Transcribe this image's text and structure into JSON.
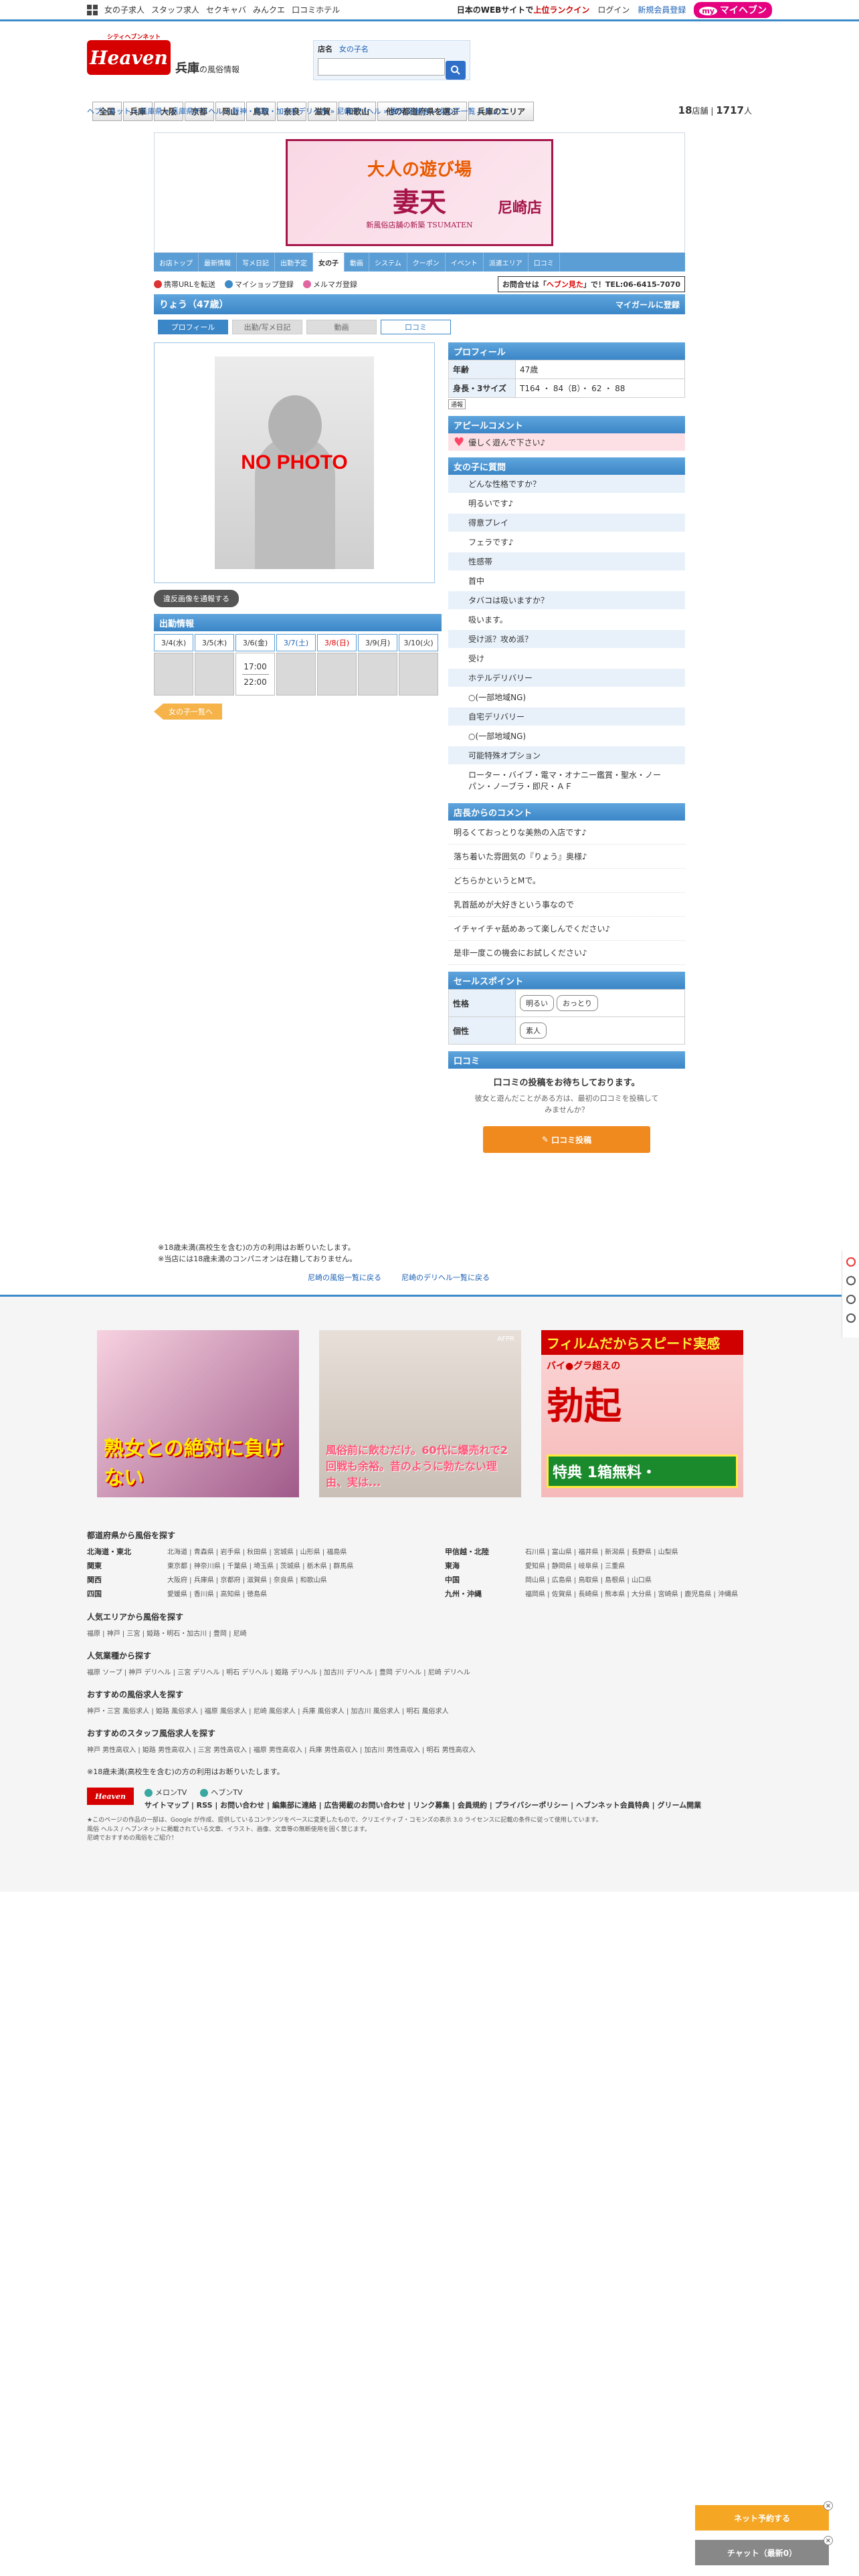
{
  "topbar": {
    "left_links": [
      "女の子求人",
      "スタッフ求人",
      "セクキャバ",
      "みんクエ",
      "口コミホテル"
    ],
    "right_links": [
      {
        "text": "日本のWEBサイトで",
        "style": "dark"
      },
      {
        "text": "上位ランクイン",
        "style": "hl"
      },
      {
        "text": "ログイン",
        "style": "plain"
      },
      {
        "text": "新規会員登録",
        "style": "blue"
      }
    ],
    "my_heaven": "マイヘブン",
    "my_badge": "my"
  },
  "header": {
    "logo_text": "Heaven",
    "logo_sub": "シティヘブンネット",
    "pref": "兵庫",
    "pref_sub": "の風俗情報",
    "search_label": "店名",
    "search_tab": "女の子名",
    "search_placeholder": ""
  },
  "gnav": [
    "全国",
    "兵庫",
    "大阪",
    "京都",
    "岡山",
    "鳥取",
    "奈良",
    "滋賀",
    "和歌山",
    "他の都道府県を選ぶ",
    "兵庫のエリア"
  ],
  "breadcrumb": "ヘブンネット » 兵庫県 » 兵庫県デリヘル » 阪神・尼崎・加古川デリヘル » 尼崎デリヘル » 妻天 尼崎店 » 女の子一覧 » りょう",
  "counts": {
    "shops": "18",
    "shops_unit": "店舗",
    "divider": "|",
    "girls": "1717",
    "girls_unit": "人"
  },
  "banner": {
    "t1": "大人の遊び場",
    "t2": "妻天",
    "t3": "尼崎店",
    "t4": "新風俗店舗の新築 TSUMATEN"
  },
  "subnav": [
    "お店トップ",
    "最新情報",
    "写メ日記",
    "出勤予定",
    "女の子",
    "動画",
    "システム",
    "クーポン",
    "イベント",
    "派遣エリア",
    "口コミ"
  ],
  "subnav_active": "女の子",
  "tools": {
    "items": [
      "携帯URLを転送",
      "マイショップ登録",
      "メルマガ登録"
    ],
    "tel_prefix": "お問合せは「",
    "tel_highlight": "ヘブン見た",
    "tel_suffix": "」で！TEL:06-6415-7070"
  },
  "girl": {
    "name": "りょう（47歳）",
    "mygirl": "マイガールに登録"
  },
  "ptabs": [
    "プロフィール",
    "出勤/写メ日記",
    "動画",
    "口コミ"
  ],
  "photo": {
    "label": "NO PHOTO"
  },
  "violate_btn": "違反画像を通報する",
  "schedule": {
    "title": "出勤情報",
    "days": [
      {
        "label": "3/4(水)",
        "type": "",
        "time_start": "",
        "time_end": "",
        "on": false
      },
      {
        "label": "3/5(木)",
        "type": "",
        "time_start": "",
        "time_end": "",
        "on": false
      },
      {
        "label": "3/6(金)",
        "type": "",
        "time_start": "17:00",
        "time_end": "22:00",
        "on": true
      },
      {
        "label": "3/7(土)",
        "type": "sat",
        "time_start": "",
        "time_end": "",
        "on": false
      },
      {
        "label": "3/8(日)",
        "type": "sun",
        "time_start": "",
        "time_end": "",
        "on": false
      },
      {
        "label": "3/9(月)",
        "type": "",
        "time_start": "",
        "time_end": "",
        "on": false
      },
      {
        "label": "3/10(火)",
        "type": "",
        "time_start": "",
        "time_end": "",
        "on": false
      }
    ]
  },
  "to_list": "女の子一覧へ",
  "profile": {
    "title": "プロフィール",
    "rows": [
      {
        "k": "年齢",
        "v": "47歳"
      },
      {
        "k": "身長・3サイズ",
        "v": "T164 ・ 84（B）・ 62 ・ 88"
      }
    ],
    "src_btn": "通報"
  },
  "appeal": {
    "title": "アピールコメント",
    "text": "優しく遊んで下さい♪"
  },
  "qa": {
    "title": "女の子に質問",
    "items": [
      {
        "q": "どんな性格ですか？",
        "a": "明るいです♪"
      },
      {
        "q": "得意プレイ",
        "a": "フェラです♪"
      },
      {
        "q": "性感帯",
        "a": "首中"
      },
      {
        "q": "タバコは吸いますか？",
        "a": "吸います。"
      },
      {
        "q": "受け派？攻め派？",
        "a": "受け"
      },
      {
        "q": "ホテルデリバリー",
        "a": "○(一部地域NG)"
      },
      {
        "q": "自宅デリバリー",
        "a": "○(一部地域NG)"
      },
      {
        "q": "可能特殊オプション",
        "a": "ローター・バイブ・電マ・オナニー鑑賞・聖水・ノーパン・ノーブラ・即尺・ＡＦ"
      }
    ]
  },
  "shop_comment": {
    "title": "店長からのコメント",
    "lines": [
      "明るくておっとりな美熟の入店です♪",
      "落ち着いた雰囲気の『りょう』奥様♪",
      "どちらかというとMで。",
      "乳首舐めが大好きという事なので",
      "イチャイチャ舐めあって楽しんでください♪",
      "是非一度この機会にお試しください♪"
    ]
  },
  "sales": {
    "title": "セールスポイント",
    "rows": [
      {
        "k": "性格",
        "tags": [
          "明るい",
          "おっとり"
        ]
      },
      {
        "k": "個性",
        "tags": [
          "素人"
        ]
      }
    ]
  },
  "kuchikomi": {
    "title": "口コミ",
    "t": "口コミの投稿をお待ちしております。",
    "s1": "彼女と遊んだことがある方は、最初の口コミを投稿して",
    "s2": "みませんか？",
    "btn": "口コミ投稿"
  },
  "notes": [
    "※18歳未満(高校生を含む)の方の利用はお断りいたします。",
    "※当店には18歳未満のコンパニオンは在籍しておりません。"
  ],
  "backlinks": [
    "尼崎の風俗一覧に戻る",
    "尼崎のデリヘル一覧に戻る"
  ],
  "ads": {
    "a1": "熟女との絶対に負けない",
    "a2": "風俗前に飲むだけ。60代に爆売れで2回戦も余裕。昔のように勃たない理由、実は...",
    "a2_tag": "AFPR",
    "a3_top": "フィルムだからスピード実感",
    "a3_mid": "バイ●グラ超えの",
    "a3_big": "勃起",
    "a3_tok": "特典 1箱無料・"
  },
  "footer": {
    "regions_title": "都道府県から風俗を探す",
    "regions": [
      {
        "name": "北海道・東北",
        "prefs": "北海道 | 青森県 | 岩手県 | 秋田県 | 宮城県 | 山形県 | 福島県"
      },
      {
        "name": "甲信越・北陸",
        "prefs": "石川県 | 富山県 | 福井県 | 新潟県 | 長野県 | 山梨県"
      },
      {
        "name": "関東",
        "prefs": "東京都 | 神奈川県 | 千葉県 | 埼玉県 | 茨城県 | 栃木県 | 群馬県"
      },
      {
        "name": "東海",
        "prefs": "愛知県 | 静岡県 | 岐阜県 | 三重県"
      },
      {
        "name": "関西",
        "prefs": "大阪府 | 兵庫県 | 京都府 | 滋賀県 | 奈良県 | 和歌山県"
      },
      {
        "name": "中国",
        "prefs": "岡山県 | 広島県 | 鳥取県 | 島根県 | 山口県"
      },
      {
        "name": "四国",
        "prefs": "愛媛県 | 香川県 | 高知県 | 徳島県"
      },
      {
        "name": "九州・沖縄",
        "prefs": "福岡県 | 佐賀県 | 長崎県 | 熊本県 | 大分県 | 宮崎県 | 鹿児島県 | 沖縄県"
      }
    ],
    "popular_area_title": "人気エリアから風俗を探す",
    "popular_area": "福原 | 神戸 | 三宮 | 姫路・明石・加古川 | 豊岡 | 尼崎",
    "popular_type_title": "人気業種から探す",
    "popular_type": "福原 ソープ | 神戸 デリヘル | 三宮 デリヘル | 明石 デリヘル | 姫路 デリヘル | 加古川 デリヘル | 豊岡 デリヘル | 尼崎 デリヘル",
    "recruit_title": "おすすめの風俗求人を探す",
    "recruit": "神戸・三宮 風俗求人 | 姫路 風俗求人 | 福原 風俗求人 | 尼崎 風俗求人 | 兵庫 風俗求人 | 加古川 風俗求人 | 明石 風俗求人",
    "staff_title": "おすすめのスタッフ風俗求人を探す",
    "staff": "神戸 男性高収入 | 姫路 男性高収入 | 三宮 男性高収入 | 福原 男性高収入 | 兵庫 男性高収入 | 加古川 男性高収入 | 明石 男性高収入",
    "age_note": "※18歳未満(高校生を含む)の方の利用はお断りいたします。",
    "tv1": "メロンTV",
    "tv2": "ヘブンTV",
    "footer_links": "サイトマップ | RSS | お問い合わせ | 編集部に連絡 | 広告掲載のお問い合わせ | リンク募集 | 会員規約 | プライバシーポリシー | ヘブンネット会員特典 | グリーム開業",
    "disclaimer1": "★このページの作品の一部は、Google が作成、提供しているコンテンツをベースに変更したもので、クリエイティブ・コモンズの表示 3.0 ライセンスに記載の条件に従って使用しています。",
    "disclaimer2": "風俗 ヘルス / ヘブンネットに掲載されている文章、イラスト、画像、文章等の無断使用を固く禁じます。",
    "disclaimer3": "尼崎でおすすめの風俗をご紹介！"
  },
  "float": {
    "b1": "ネット予約する",
    "b2": "チャット（最新0）"
  }
}
